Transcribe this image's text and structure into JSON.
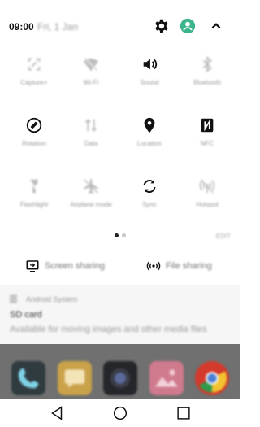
{
  "status": {
    "time": "09:00",
    "date": "Fri, 1 Jan"
  },
  "header_icons": [
    "settings-gear-icon",
    "profile-icon",
    "chevron-up-icon"
  ],
  "tiles": [
    {
      "name": "capture-plus",
      "label": "Capture+",
      "icon": "crop-icon",
      "state": "off"
    },
    {
      "name": "wifi",
      "label": "Wi-Fi",
      "icon": "wifi-off-icon",
      "state": "off"
    },
    {
      "name": "sound",
      "label": "Sound",
      "icon": "speaker-icon",
      "state": "on"
    },
    {
      "name": "bluetooth",
      "label": "Bluetooth",
      "icon": "bluetooth-icon",
      "state": "off"
    },
    {
      "name": "rotation",
      "label": "Rotation",
      "icon": "rotation-lock-icon",
      "state": "on"
    },
    {
      "name": "data",
      "label": "Data",
      "icon": "data-arrows-icon",
      "state": "off"
    },
    {
      "name": "location",
      "label": "Location",
      "icon": "location-pin-icon",
      "state": "on"
    },
    {
      "name": "nfc",
      "label": "NFC",
      "icon": "nfc-icon",
      "state": "on"
    },
    {
      "name": "flashlight",
      "label": "Flashlight",
      "icon": "flashlight-icon",
      "state": "off"
    },
    {
      "name": "airplane-mode",
      "label": "Airplane mode",
      "icon": "airplane-icon",
      "state": "off"
    },
    {
      "name": "sync",
      "label": "Sync",
      "icon": "sync-icon",
      "state": "on"
    },
    {
      "name": "hotspot",
      "label": "Hotspot",
      "icon": "hotspot-icon",
      "state": "off"
    }
  ],
  "pager": {
    "pages": 2,
    "active": 1
  },
  "edit_label": "EDIT",
  "share": {
    "screen_sharing": "Screen sharing",
    "file_sharing": "File sharing"
  },
  "notification": {
    "app": "Android System",
    "title": "SD card",
    "body": "Available for moving images and other media files"
  },
  "dock": [
    {
      "name": "phone-app",
      "icon": "phone-icon",
      "color": "#2f3b3f"
    },
    {
      "name": "messages-app",
      "icon": "message-icon",
      "color": "#c9a24a"
    },
    {
      "name": "camera-app",
      "icon": "camera-icon",
      "color": "#25262a"
    },
    {
      "name": "gallery-app",
      "icon": "gallery-icon",
      "color": "#d07a8e"
    },
    {
      "name": "chrome-app",
      "icon": "chrome-icon",
      "color": "#d33a2c"
    }
  ],
  "nav": [
    "back-icon",
    "home-icon",
    "recents-icon"
  ],
  "colors": {
    "accent": "#3cb48c",
    "icon": "#111111",
    "muted": "#9a9a9a",
    "home_bg": "#707070"
  }
}
